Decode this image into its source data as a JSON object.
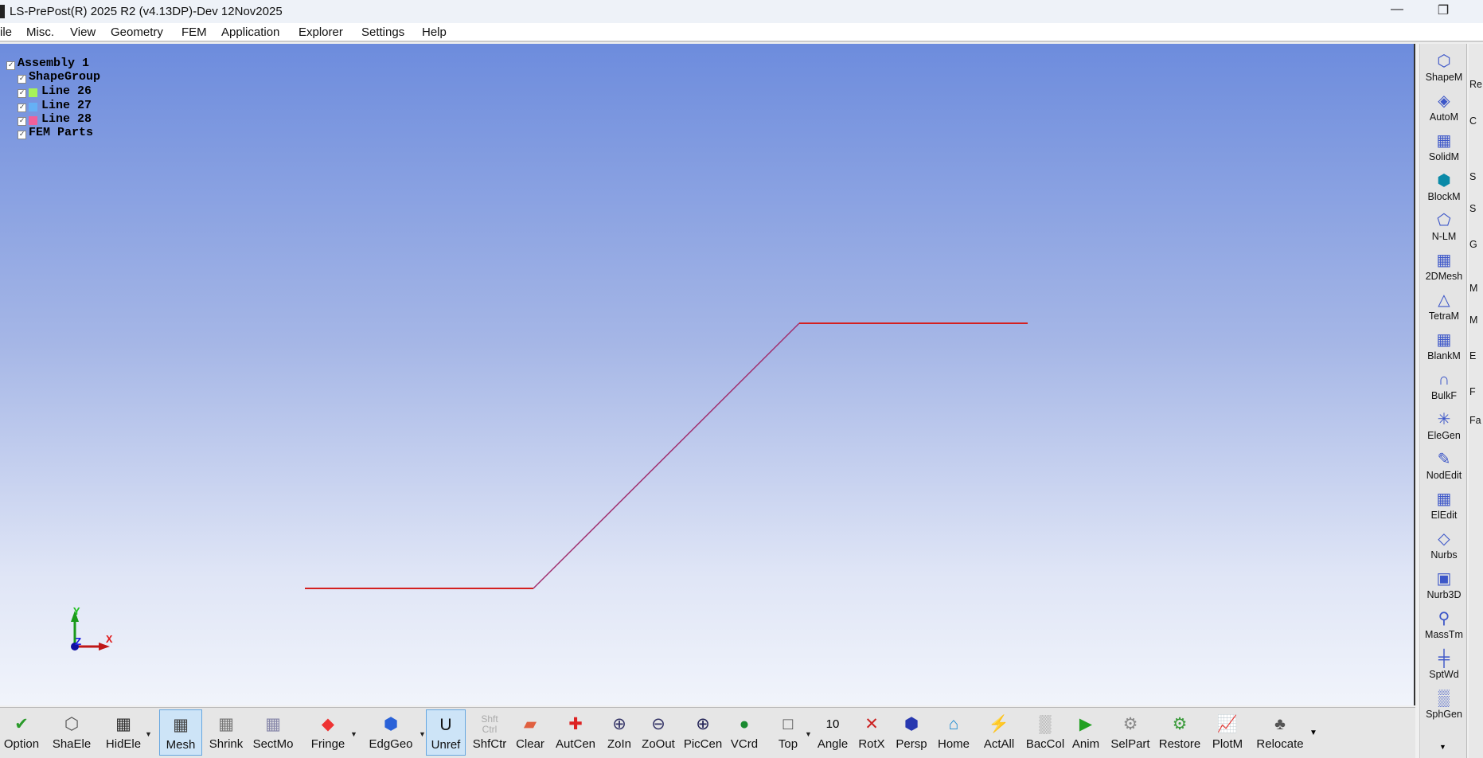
{
  "window": {
    "title": "LS-PrePost(R) 2025 R2 (v4.13DP)-Dev 12Nov2025",
    "minimize": "—",
    "restore": "❐"
  },
  "menu": [
    "ile",
    "Misc.",
    "View",
    "Geometry",
    "FEM",
    "Application",
    "Explorer",
    "Settings",
    "Help"
  ],
  "tree": {
    "assembly": "Assembly 1",
    "group": "ShapeGroup",
    "lines": [
      {
        "label": "Line 26",
        "color": "#a6f25a"
      },
      {
        "label": "Line 27",
        "color": "#66b0f5"
      },
      {
        "label": "Line 28",
        "color": "#f0609a"
      }
    ],
    "fem": "FEM Parts"
  },
  "axes": {
    "x": "X",
    "y": "Y",
    "z": "Z"
  },
  "colors": {
    "line": "#d42020",
    "diag": "#a03070"
  },
  "right_toolbar": [
    {
      "label": "ShapeM",
      "icon": "cube-wire-icon"
    },
    {
      "label": "AutoM",
      "icon": "auto-mesh-icon"
    },
    {
      "label": "SolidM",
      "icon": "solid-mesh-icon"
    },
    {
      "label": "BlockM",
      "icon": "block-mesh-icon"
    },
    {
      "label": "N-LM",
      "icon": "nlm-icon"
    },
    {
      "label": "2DMesh",
      "icon": "2d-mesh-icon"
    },
    {
      "label": "TetraM",
      "icon": "tetra-mesh-icon"
    },
    {
      "label": "BlankM",
      "icon": "blank-mesh-icon"
    },
    {
      "label": "BulkF",
      "icon": "bulk-form-icon"
    },
    {
      "label": "EleGen",
      "icon": "element-gen-icon"
    },
    {
      "label": "NodEdit",
      "icon": "pencil-icon"
    },
    {
      "label": "ElEdit",
      "icon": "element-edit-icon"
    },
    {
      "label": "Nurbs",
      "icon": "nurbs-icon"
    },
    {
      "label": "Nurb3D",
      "icon": "nurbs-3d-icon"
    },
    {
      "label": "MassTm",
      "icon": "mass-trim-icon"
    },
    {
      "label": "SptWd",
      "icon": "spotweld-icon"
    },
    {
      "label": "SphGen",
      "icon": "sph-gen-icon"
    }
  ],
  "right_toolbar2": [
    "Re",
    "C",
    "S",
    "S",
    "G",
    "M",
    "M",
    "E",
    "F",
    "Fa"
  ],
  "bottom_toolbar": [
    {
      "label": "Option",
      "icon": "option-icon"
    },
    {
      "label": "ShaEle",
      "icon": "shaded-element-icon"
    },
    {
      "label": "HidEle",
      "icon": "hidden-element-icon"
    },
    {
      "label": "Mesh",
      "icon": "mesh-icon",
      "active": true
    },
    {
      "label": "Shrink",
      "icon": "shrink-icon"
    },
    {
      "label": "SectMo",
      "icon": "section-mode-icon"
    },
    {
      "label": "Fringe",
      "icon": "fringe-icon"
    },
    {
      "label": "EdgGeo",
      "icon": "edge-geometry-icon"
    },
    {
      "label": "Unref",
      "icon": "unreferenced-icon",
      "active": true
    },
    {
      "label": "ShfCtr",
      "icon": "shift-ctrl-icon"
    },
    {
      "label": "Clear",
      "icon": "eraser-icon"
    },
    {
      "label": "AutCen",
      "icon": "auto-center-icon"
    },
    {
      "label": "ZoIn",
      "icon": "zoom-in-icon"
    },
    {
      "label": "ZoOut",
      "icon": "zoom-out-icon"
    },
    {
      "label": "PicCen",
      "icon": "pick-center-icon"
    },
    {
      "label": "VCrd",
      "icon": "view-coord-icon"
    },
    {
      "label": "Top",
      "icon": "top-view-icon"
    },
    {
      "label": "Angle",
      "icon": "angle-icon",
      "text": "10"
    },
    {
      "label": "RotX",
      "icon": "rotate-x-icon"
    },
    {
      "label": "Persp",
      "icon": "perspective-icon"
    },
    {
      "label": "Home",
      "icon": "home-icon"
    },
    {
      "label": "ActAll",
      "icon": "activate-all-icon"
    },
    {
      "label": "BacCol",
      "icon": "background-color-icon"
    },
    {
      "label": "Anim",
      "icon": "play-icon"
    },
    {
      "label": "SelPart",
      "icon": "select-part-icon"
    },
    {
      "label": "Restore",
      "icon": "restore-icon"
    },
    {
      "label": "PlotM",
      "icon": "plot-icon"
    },
    {
      "label": "Relocate",
      "icon": "relocate-icon"
    }
  ],
  "shfctr_text": "Shft Ctrl"
}
